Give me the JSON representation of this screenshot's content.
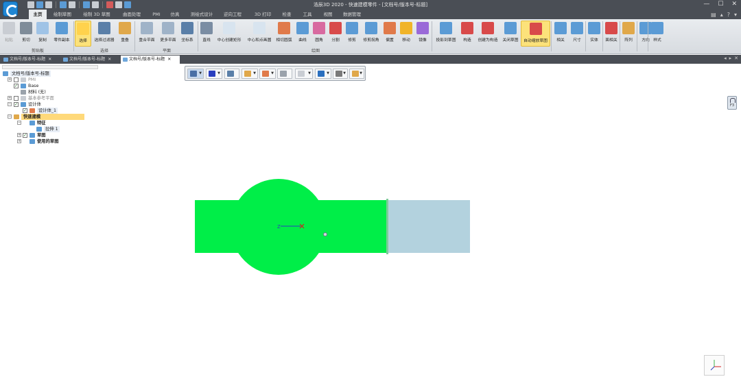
{
  "window": {
    "title": "浩辰3D 2020 - 快速建模零件 - [文档号/版本号-标题]"
  },
  "ribbon_tabs": [
    {
      "label": "主页",
      "active": true
    },
    {
      "label": "绘制草图",
      "active": false
    },
    {
      "label": "绘制 3D 草图",
      "active": false
    },
    {
      "label": "曲面处理",
      "active": false
    },
    {
      "label": "PMI",
      "active": false
    },
    {
      "label": "仿真",
      "active": false
    },
    {
      "label": "测绘式设计",
      "active": false
    },
    {
      "label": "逆向工程",
      "active": false
    },
    {
      "label": "3D 打印",
      "active": false
    },
    {
      "label": "检查",
      "active": false
    },
    {
      "label": "工具",
      "active": false
    },
    {
      "label": "视图",
      "active": false
    },
    {
      "label": "数据管理",
      "active": false
    }
  ],
  "ribbon": {
    "buttons": [
      {
        "label": "粘贴",
        "icon": "paste-icon",
        "color": "#c9cdd3"
      },
      {
        "label": "剪切",
        "icon": "cut-icon",
        "color": "#7f8c99"
      },
      {
        "label": "复制",
        "icon": "copy-icon",
        "color": "#9fc3e6"
      },
      {
        "label": "零件副本",
        "icon": "part-copy-icon",
        "color": "#5b9bd5"
      },
      {
        "label": "选择",
        "icon": "select-cursor-icon",
        "color": "#ffd24d"
      },
      {
        "label": "选择过滤器",
        "icon": "filter-icon",
        "color": "#5a7fa8"
      },
      {
        "label": "重叠",
        "icon": "overlap-icon",
        "color": "#e0a84a"
      },
      {
        "label": "重合平面",
        "icon": "coincident-plane-icon",
        "color": "#9fb3c8"
      },
      {
        "label": "更多平面",
        "icon": "more-planes-icon",
        "color": "#9fb3c8"
      },
      {
        "label": "坐标系",
        "icon": "coordinate-system-icon",
        "color": "#5a7fa8"
      },
      {
        "label": "直线",
        "icon": "line-icon",
        "color": "#7a8da3"
      },
      {
        "label": "中心创建矩形",
        "icon": "center-rect-icon",
        "color": "#d8e4ef"
      },
      {
        "label": "中心和点画圆",
        "icon": "circle-icon",
        "color": "#d8e4ef"
      },
      {
        "label": "相切圆弧",
        "icon": "tangent-arc-icon",
        "color": "#e07a4a"
      },
      {
        "label": "曲线",
        "icon": "curve-icon",
        "color": "#5b9bd5"
      },
      {
        "label": "圆角",
        "icon": "fillet-icon",
        "color": "#d86aa0"
      },
      {
        "label": "分割",
        "icon": "split-icon",
        "color": "#d84a4a"
      },
      {
        "label": "修剪",
        "icon": "trim-icon",
        "color": "#5b9bd5"
      },
      {
        "label": "修剪拐角",
        "icon": "trim-corner-icon",
        "color": "#5b9bd5"
      },
      {
        "label": "偏置",
        "icon": "offset-icon",
        "color": "#e07a4a"
      },
      {
        "label": "移动",
        "icon": "move-icon",
        "color": "#f0b429"
      },
      {
        "label": "镜像",
        "icon": "mirror-icon",
        "color": "#9a6ad8"
      },
      {
        "label": "投影到草图",
        "icon": "project-to-sketch-icon",
        "color": "#5b9bd5"
      },
      {
        "label": "构造",
        "icon": "construction-icon",
        "color": "#d84a4a"
      },
      {
        "label": "创建为构造",
        "icon": "create-construction-icon",
        "color": "#d84a4a"
      },
      {
        "label": "关闭草图",
        "icon": "close-sketch-icon",
        "color": "#5b9bd5"
      },
      {
        "label": "自动缩放草图",
        "icon": "auto-scale-sketch-icon",
        "color": "#d84a4a"
      },
      {
        "label": "相关",
        "icon": "relate-icon",
        "color": "#5b9bd5"
      },
      {
        "label": "尺寸",
        "icon": "dimension-icon",
        "color": "#5b9bd5"
      },
      {
        "label": "实体",
        "icon": "solid-icon",
        "color": "#5b9bd5"
      },
      {
        "label": "面相关",
        "icon": "face-relate-icon",
        "color": "#d84a4a"
      },
      {
        "label": "阵列",
        "icon": "pattern-icon",
        "color": "#e0a84a"
      },
      {
        "label": "方向",
        "icon": "direction-icon",
        "color": "#5b9bd5"
      },
      {
        "label": "样式",
        "icon": "style-icon",
        "color": "#5b9bd5"
      }
    ],
    "groups": [
      {
        "label": "剪贴板"
      },
      {
        "label": "选择"
      },
      {
        "label": "平面"
      },
      {
        "label": "绘图"
      }
    ]
  },
  "doc_tabs": [
    {
      "label": "文档号/版本号-标题",
      "active": false
    },
    {
      "label": "文档号/版本号-标题",
      "active": false
    },
    {
      "label": "文档号/版本号-标题",
      "active": true
    }
  ],
  "tree": {
    "root": "文档号/版本号-标题",
    "pmi": "PMI",
    "base": "Base",
    "material": "材料 (无)",
    "ref_planes": "基本参考平面",
    "design_body": "设计体",
    "design_body_1": "设计体_1",
    "quick_model": "快速建模",
    "features": "特征",
    "extrude_1": "拉伸 1",
    "sketch": "草图",
    "used_sketch": "使用的草图"
  },
  "float_toolbar": {
    "buttons": [
      {
        "icon": "shaded-view-icon",
        "color": "#4a6fa5"
      },
      {
        "icon": "line-color-icon",
        "color": "#2a3fbf"
      },
      {
        "icon": "coordinate-display-icon",
        "color": "#5a7fa8"
      },
      {
        "icon": "snap-icon",
        "color": "#e0a84a"
      },
      {
        "icon": "box-select-icon",
        "color": "#e07a4a"
      },
      {
        "icon": "section-view-icon",
        "color": "#9aa2ab"
      },
      {
        "icon": "display-panel-icon",
        "color": "#c9cdd3"
      },
      {
        "icon": "view-style-icon",
        "color": "#2a6fbf"
      },
      {
        "icon": "grid-icon",
        "color": "#7a7a7a"
      },
      {
        "icon": "render-settings-icon",
        "color": "#e0a84a"
      }
    ]
  },
  "canvas": {
    "sketch_fill_color": "#00ee48",
    "selected_face_color": "#b3d2de",
    "triad_z_label": "Z",
    "view_cube_icon": "view-orientation-triad-icon",
    "lock_label": "F3"
  }
}
